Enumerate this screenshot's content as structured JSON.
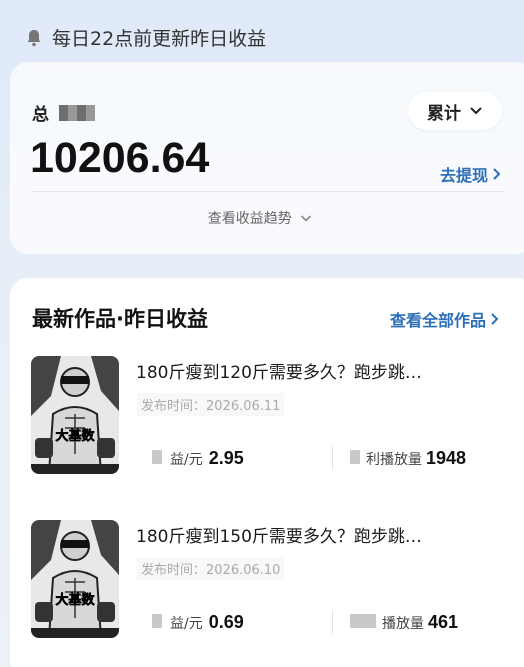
{
  "notice": {
    "text": "每日22点前更新昨日收益",
    "icon": "bell-icon"
  },
  "summary": {
    "total_label": "总",
    "total_value": "10206.64",
    "range_label": "累计",
    "withdraw_label": "去提现",
    "trend_label": "查看收益趋势"
  },
  "works": {
    "title": "最新作品·昨日收益",
    "see_all_label": "查看全部作品",
    "items": [
      {
        "title": "180斤瘦到120斤需要多久？跑步跳…",
        "date": "发布时间：2026.06.11",
        "income_label": "益/元",
        "income_value": "2.95",
        "plays_label": "利播放量",
        "plays_value": "1948",
        "thumb_text": "大基数"
      },
      {
        "title": "180斤瘦到150斤需要多久？跑步跳…",
        "date": "发布时间：2026.06.10",
        "income_label": "益/元",
        "income_value": "0.69",
        "plays_label": "播放量",
        "plays_value": "461",
        "thumb_text": "大基数"
      }
    ]
  },
  "colors": {
    "accent": "#2d6fb7",
    "bg": "#e3ebf7"
  }
}
